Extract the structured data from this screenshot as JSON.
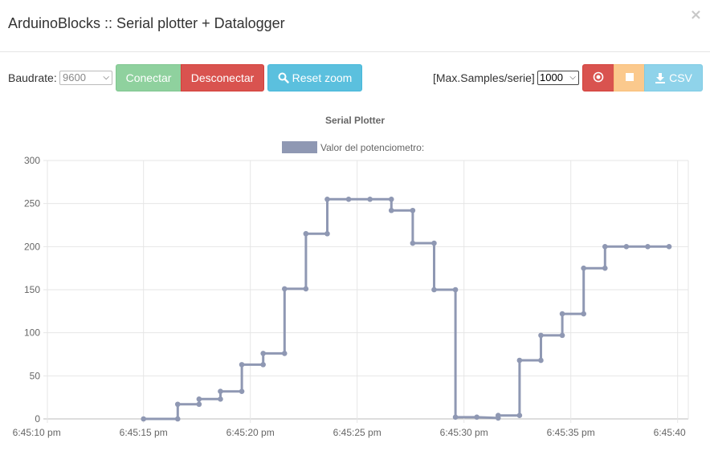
{
  "window": {
    "title": "ArduinoBlocks :: Serial plotter + Datalogger",
    "close_glyph": "×"
  },
  "toolbar": {
    "baudrate_label": "Baudrate:",
    "baudrate_value": "9600",
    "connect_label": "Conectar",
    "disconnect_label": "Desconectar",
    "reset_zoom_label": "Reset zoom",
    "max_samples_label": "[Max.Samples/serie]",
    "max_samples_value": "1000",
    "csv_label": "CSV"
  },
  "icons": {
    "reset_zoom": "search-icon",
    "record": "record-icon",
    "stop": "stop-icon",
    "csv": "download-icon",
    "close": "close-icon"
  },
  "colors": {
    "connect": "#8fd19e",
    "disconnect": "#d9534f",
    "reset_zoom": "#5bc0de",
    "record": "#d9534f",
    "stop": "#fbc98d",
    "csv": "#8fd3ea",
    "series": "#8f98b3"
  },
  "chart_data": {
    "type": "line",
    "title": "Serial Plotter",
    "xlabel": "",
    "ylabel": "",
    "legend_position": "top-center",
    "grid": true,
    "ylim": [
      0,
      300
    ],
    "y_ticks": [
      0,
      50,
      100,
      150,
      200,
      250,
      300
    ],
    "xlim": [
      10.5,
      40.5
    ],
    "x_ticks": [
      {
        "t": 10,
        "label": "6:45:10 pm"
      },
      {
        "t": 15,
        "label": "6:45:15 pm"
      },
      {
        "t": 20,
        "label": "6:45:20 pm"
      },
      {
        "t": 25,
        "label": "6:45:25 pm"
      },
      {
        "t": 30,
        "label": "6:45:30 pm"
      },
      {
        "t": 35,
        "label": "6:45:35 pm"
      },
      {
        "t": 40,
        "label": "6:45:40 pm"
      }
    ],
    "series": [
      {
        "name": "Valor del potenciometro:",
        "stepped": true,
        "points": [
          [
            15,
            0
          ],
          [
            16.6,
            0
          ],
          [
            16.6,
            17
          ],
          [
            17.6,
            17
          ],
          [
            17.6,
            23
          ],
          [
            18.6,
            23
          ],
          [
            18.6,
            32
          ],
          [
            19.6,
            32
          ],
          [
            19.6,
            63
          ],
          [
            20.6,
            63
          ],
          [
            20.6,
            76
          ],
          [
            21.6,
            76
          ],
          [
            21.6,
            151
          ],
          [
            22.6,
            151
          ],
          [
            22.6,
            215
          ],
          [
            23.6,
            215
          ],
          [
            23.6,
            255
          ],
          [
            24.6,
            255
          ],
          [
            25.6,
            255
          ],
          [
            26.6,
            255
          ],
          [
            26.6,
            242
          ],
          [
            27.6,
            242
          ],
          [
            27.6,
            204
          ],
          [
            28.6,
            204
          ],
          [
            28.6,
            150
          ],
          [
            29.6,
            150
          ],
          [
            29.6,
            2
          ],
          [
            30.6,
            2
          ],
          [
            31.6,
            1
          ],
          [
            31.6,
            4
          ],
          [
            32.6,
            4
          ],
          [
            32.6,
            68
          ],
          [
            33.6,
            68
          ],
          [
            33.6,
            97
          ],
          [
            34.6,
            97
          ],
          [
            34.6,
            122
          ],
          [
            35.6,
            122
          ],
          [
            35.6,
            175
          ],
          [
            36.6,
            175
          ],
          [
            36.6,
            200
          ],
          [
            37.6,
            200
          ],
          [
            38.6,
            200
          ],
          [
            39.6,
            200
          ]
        ]
      }
    ]
  }
}
